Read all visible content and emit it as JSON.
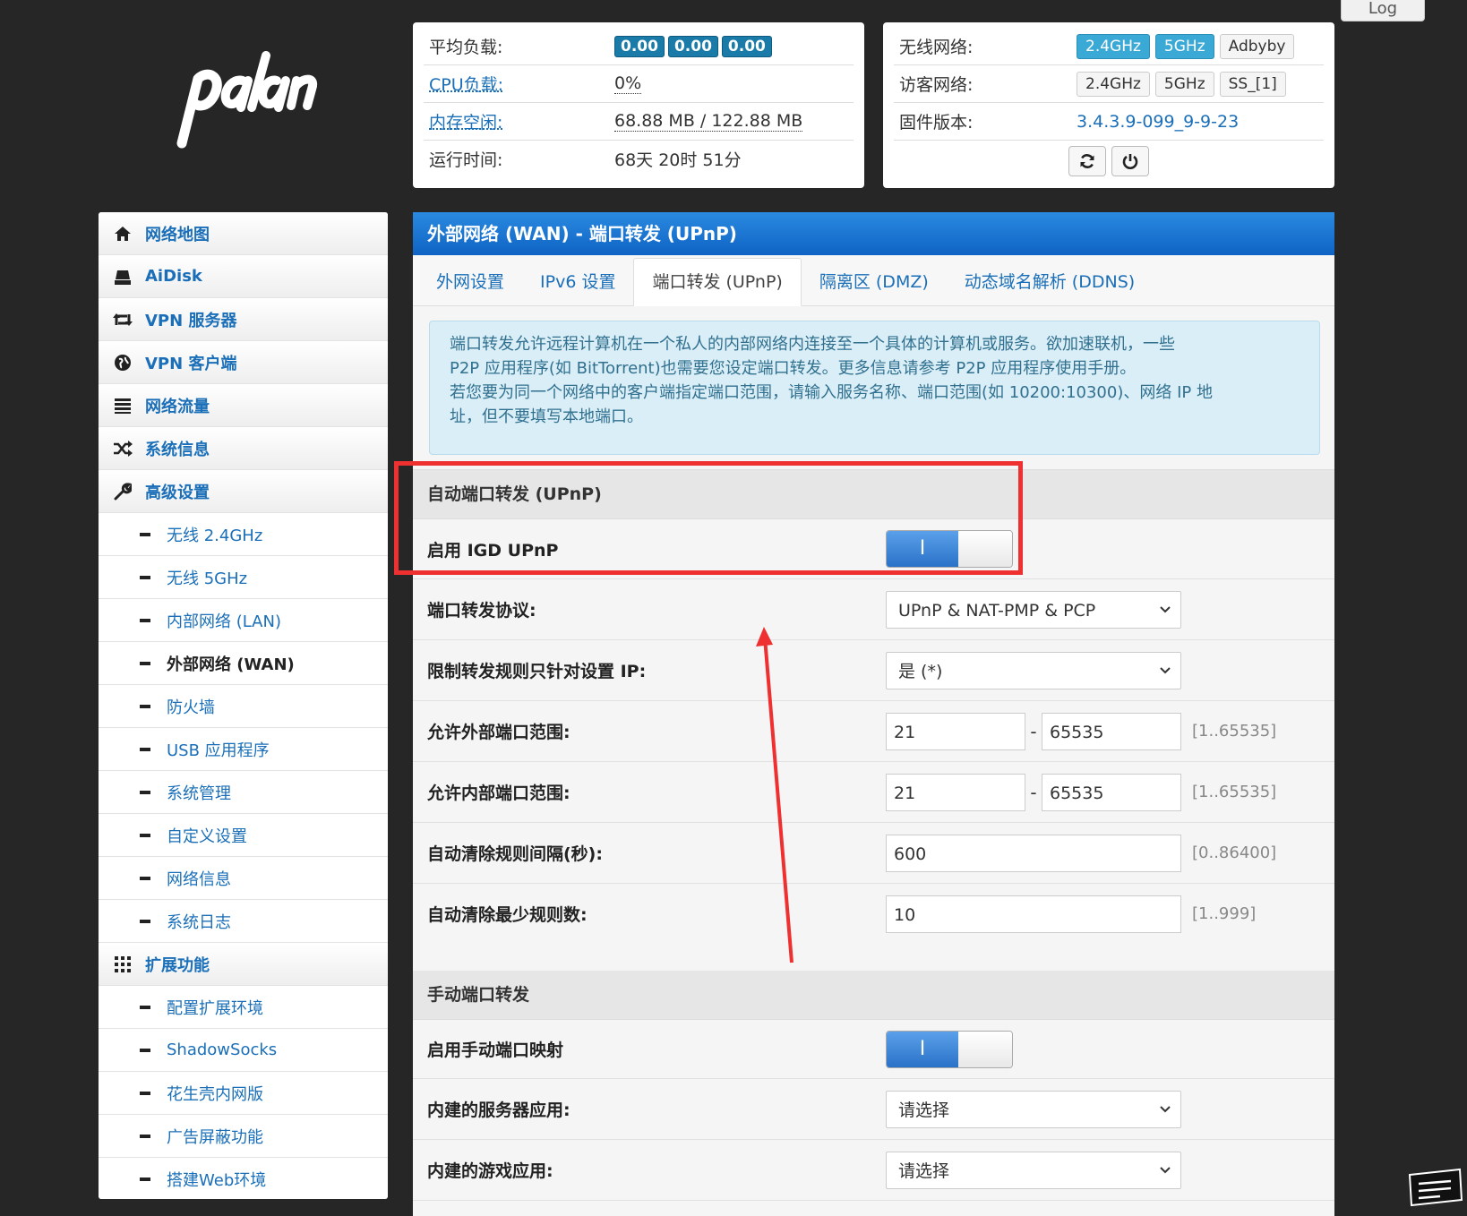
{
  "log_label": "Log",
  "status": {
    "load_label": "平均负载:",
    "load_values": [
      "0.00",
      "0.00",
      "0.00"
    ],
    "cpu_label": "CPU负载:",
    "cpu_value": "0%",
    "mem_label": "内存空闲:",
    "mem_value": "68.88 MB / 122.88 MB",
    "uptime_label": "运行时间:",
    "uptime_value": "68天 20时 51分"
  },
  "wireless": {
    "wifi_label": "无线网络:",
    "wifi_buttons": [
      "2.4GHz",
      "5GHz",
      "Adbyby"
    ],
    "guest_label": "访客网络:",
    "guest_buttons": [
      "2.4GHz",
      "5GHz",
      "SS_[1]"
    ],
    "fw_label": "固件版本:",
    "fw_value": "3.4.3.9-099_9-9-23"
  },
  "sidebar": {
    "items": [
      {
        "label": "网络地图",
        "icon": "home-icon"
      },
      {
        "label": "AiDisk",
        "icon": "drive-icon"
      },
      {
        "label": "VPN 服务器",
        "icon": "retweet-icon"
      },
      {
        "label": "VPN 客户端",
        "icon": "globe-icon"
      },
      {
        "label": "网络流量",
        "icon": "tasks-icon"
      },
      {
        "label": "系统信息",
        "icon": "random-icon"
      },
      {
        "label": "高级设置",
        "icon": "wrench-icon"
      },
      {
        "label": "无线 2.4GHz"
      },
      {
        "label": "无线 5GHz"
      },
      {
        "label": "内部网络 (LAN)"
      },
      {
        "label": "外部网络 (WAN)"
      },
      {
        "label": "防火墙"
      },
      {
        "label": "USB 应用程序"
      },
      {
        "label": "系统管理"
      },
      {
        "label": "自定义设置"
      },
      {
        "label": "网络信息"
      },
      {
        "label": "系统日志"
      },
      {
        "label": "扩展功能",
        "icon": "grid-icon"
      },
      {
        "label": "配置扩展环境"
      },
      {
        "label": "ShadowSocks"
      },
      {
        "label": "花生壳内网版"
      },
      {
        "label": "广告屏蔽功能"
      },
      {
        "label": "搭建Web环境"
      }
    ]
  },
  "main": {
    "title": "外部网络 (WAN) - 端口转发 (UPnP)",
    "tabs": [
      "外网设置",
      "IPv6 设置",
      "端口转发 (UPnP)",
      "隔离区 (DMZ)",
      "动态域名解析 (DDNS)"
    ],
    "notice_lines": [
      "端口转发允许远程计算机在一个私人的内部网络内连接至一个具体的计算机或服务。欲加速联机，一些",
      "P2P 应用程序(如 BitTorrent)也需要您设定端口转发。更多信息请参考 P2P 应用程序使用手册。",
      "若您要为同一个网络中的客户端指定端口范围，请输入服务名称、端口范围(如 10200:10300)、网络 IP 地",
      "址，但不要填写本地端口。"
    ],
    "upnp_section": "自动端口转发 (UPnP)",
    "igd_label": "启用 IGD UPnP",
    "toggle_on_glyph": "I",
    "protocol_label": "端口转发协议:",
    "protocol_value": "UPnP & NAT-PMP & PCP",
    "restrict_label": "限制转发规则只针对设置 IP:",
    "restrict_value": "是 (*)",
    "ext_range_label": "允许外部端口范围:",
    "ext_range_from": "21",
    "ext_range_to": "65535",
    "ext_range_hint": "[1..65535]",
    "int_range_label": "允许内部端口范围:",
    "int_range_from": "21",
    "int_range_to": "65535",
    "int_range_hint": "[1..65535]",
    "range_sep": "-",
    "clean_interval_label": "自动清除规则间隔(秒):",
    "clean_interval_value": "600",
    "clean_interval_hint": "[0..86400]",
    "clean_min_label": "自动清除最少规则数:",
    "clean_min_value": "10",
    "clean_min_hint": "[1..999]",
    "manual_section": "手动端口转发",
    "manual_label": "启用手动端口映射",
    "builtin_server_label": "内建的服务器应用:",
    "builtin_server_value": "请选择",
    "builtin_game_label": "内建的游戏应用:",
    "builtin_game_value": "请选择"
  },
  "colors": {
    "accent": "#1a6fb8",
    "header": "#0f63c4",
    "annotation": "#ee3030"
  }
}
